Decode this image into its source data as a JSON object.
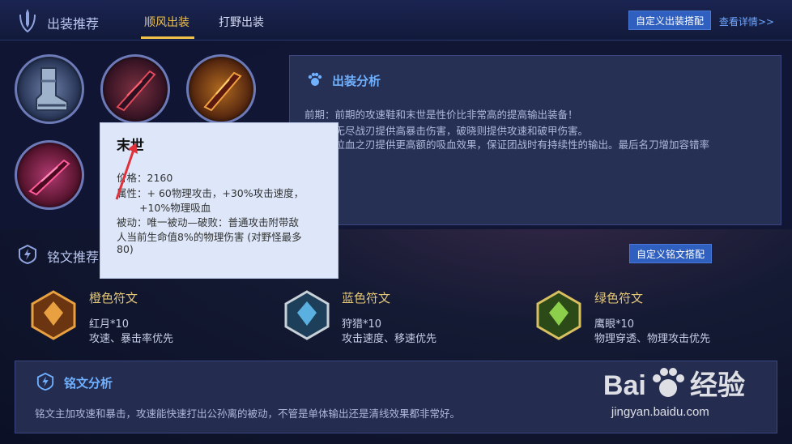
{
  "header": {
    "title": "出装推荐",
    "tabs": [
      {
        "label": "顺风出装",
        "active": true
      },
      {
        "label": "打野出装",
        "active": false
      }
    ],
    "custom_equip_button": "自定义出装搭配",
    "detail_link": "查看详情>>"
  },
  "items": [
    {
      "icon": "boots-item-icon"
    },
    {
      "icon": "doomsday-blade-icon"
    },
    {
      "icon": "storm-blade-icon"
    },
    {
      "icon": "bloodthirst-blade-icon"
    }
  ],
  "tooltip": {
    "name": "末世",
    "price": "价格：2160",
    "attr_line1": "属性：+ 60物理攻击，+30%攻击速度，",
    "attr_line2": "+10%物理吸血",
    "passive_line1": "被动：唯一被动—破败：普通攻击附带敌",
    "passive_line2": "人当前生命值8%的物理伤害 (对野怪最多",
    "passive_line3": "80)"
  },
  "equip_analysis": {
    "title": "出装分析",
    "line1": "前期：前期的攻速鞋和末世是性价比非常高的提高输出装备！",
    "line2": "中期：无尽战刃提供高暴击伤害，破晓则提供攻速和破甲伤害。",
    "line3": "后期：泣血之刃提供更高额的吸血效果，保证团战时有持续性的输出。最后名刀增加容错率"
  },
  "runes": {
    "title": "铭文推荐",
    "custom_button": "自定义铭文搭配",
    "list": [
      {
        "name": "橙色符文",
        "item": "红月*10",
        "desc": "攻速、暴击率优先",
        "color": "#d9822b"
      },
      {
        "name": "蓝色符文",
        "item": "狩猎*10",
        "desc": "攻击速度、移速优先",
        "color": "#4aa6d9"
      },
      {
        "name": "绿色符文",
        "item": "鹰眼*10",
        "desc": "物理穿透、物理攻击优先",
        "color": "#7ab83a"
      }
    ]
  },
  "rune_analysis": {
    "title": "铭文分析",
    "text": "铭文主加攻速和暴击，攻速能快速打出公孙离的被动，不管是单体输出还是清线效果都非常好。"
  },
  "watermark": {
    "brand": "Bai",
    "brand_cn": "经验",
    "url": "jingyan.baidu.com"
  }
}
